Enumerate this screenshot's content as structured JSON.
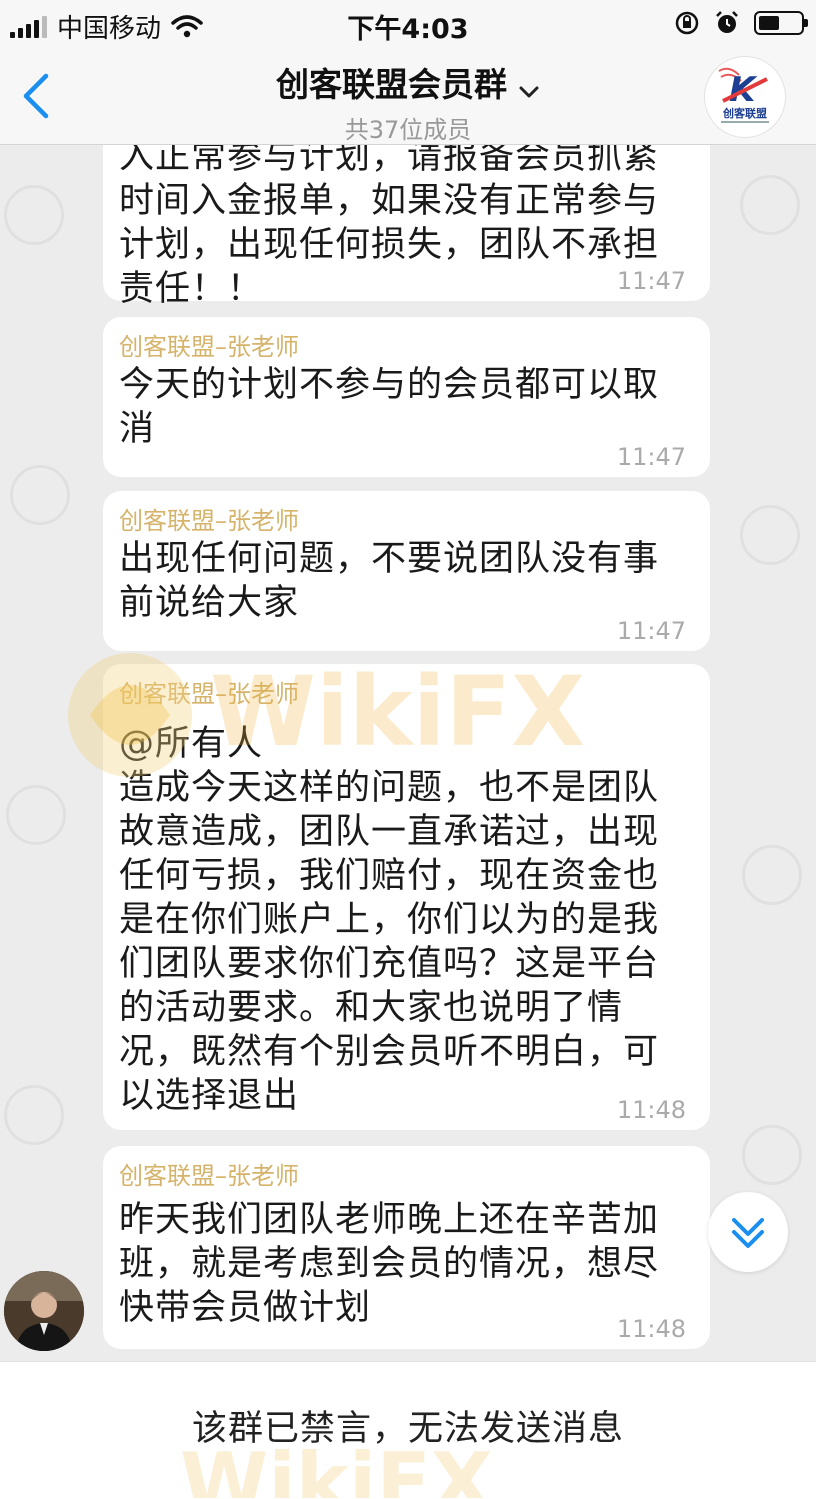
{
  "status_bar": {
    "carrier": "中国移动",
    "time": "下午4:03"
  },
  "header": {
    "title": "创客联盟会员群",
    "member_count": "共37位成员",
    "logo_letter": "K",
    "logo_text": "创客联盟"
  },
  "messages": [
    {
      "sender": "",
      "text": "入正常参与计划，请报备会员抓紧\n时间入金报单，如果没有正常参与\n计划，出现任何损失，团队不承担\n责任！！",
      "time": "11:47"
    },
    {
      "sender": "创客联盟–张老师",
      "text": "今天的计划不参与的会员都可以取\n消",
      "time": "11:47"
    },
    {
      "sender": "创客联盟–张老师",
      "text": "出现任何问题，不要说团队没有事\n前说给大家",
      "time": "11:47"
    },
    {
      "sender": "创客联盟–张老师",
      "text": "@所有人\n造成今天这样的问题，也不是团队\n故意造成，团队一直承诺过，出现\n任何亏损，我们赔付，现在资金也\n是在你们账户上，你们以为的是我\n们团队要求你们充值吗？这是平台\n的活动要求。和大家也说明了情\n况，既然有个别会员听不明白，可\n以选择退出",
      "time": "11:48"
    },
    {
      "sender": "创客联盟–张老师",
      "text": "昨天我们团队老师晚上还在辛苦加\n班，就是考虑到会员的情况，想尽\n快带会员做计划",
      "time": "11:48"
    }
  ],
  "footer": {
    "muted_notice": "该群已禁言，无法发送消息"
  },
  "watermark": "WikiFX",
  "colors": {
    "accent": "#1a8ff0",
    "sender": "#d6b36a",
    "bubble": "#ffffff",
    "background": "#ececec"
  }
}
